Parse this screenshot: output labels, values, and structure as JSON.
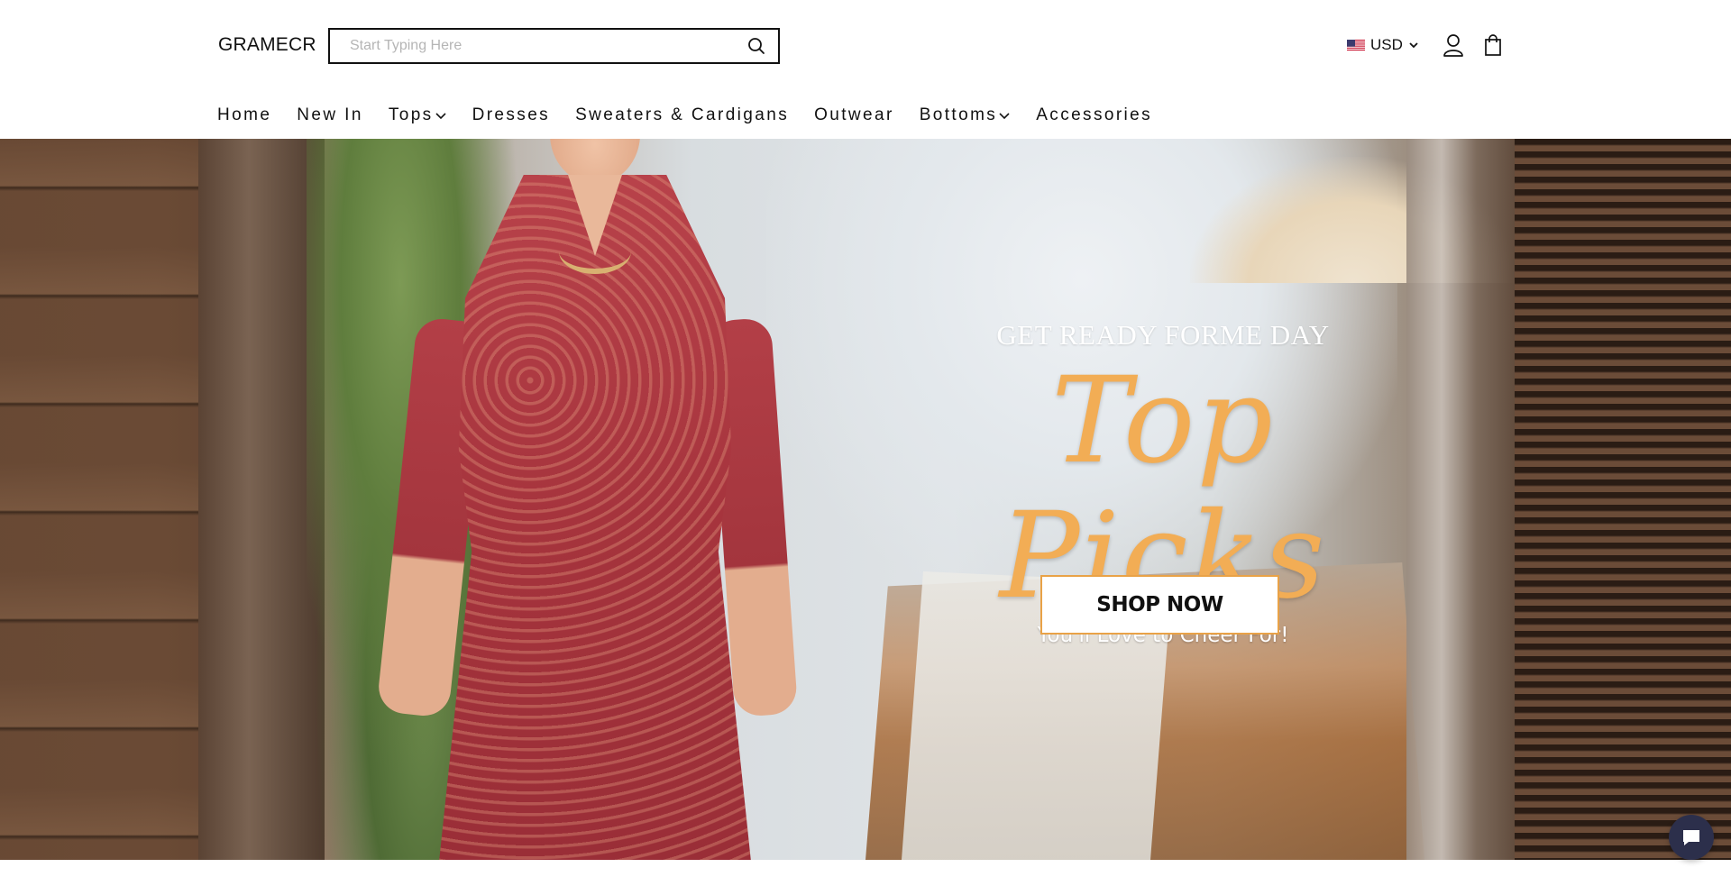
{
  "header": {
    "logo": "GRAMECR",
    "search": {
      "placeholder": "Start Typing Here",
      "value": ""
    },
    "currency": {
      "code": "USD",
      "flag": "us-flag-icon"
    },
    "icons": [
      "search-icon",
      "user-icon",
      "shopping-bag-icon",
      "chevron-down-icon"
    ]
  },
  "nav": {
    "items": [
      {
        "label": "Home",
        "has_dropdown": false
      },
      {
        "label": "New In",
        "has_dropdown": false
      },
      {
        "label": "Tops",
        "has_dropdown": true
      },
      {
        "label": "Dresses",
        "has_dropdown": false
      },
      {
        "label": "Sweaters & Cardigans",
        "has_dropdown": false
      },
      {
        "label": "Outwear",
        "has_dropdown": false
      },
      {
        "label": "Bottoms",
        "has_dropdown": true
      },
      {
        "label": "Accessories",
        "has_dropdown": false
      }
    ]
  },
  "hero": {
    "eyebrow": "GET READY FORME DAY",
    "headline": "Top Picks",
    "subline": "You'll Love to Cheer For!",
    "cta": "SHOP NOW",
    "colors": {
      "headline": "#f2ad55",
      "cta_border": "#e9a247"
    }
  },
  "chat": {
    "icon": "chat-bubble-icon",
    "color": "#2c2f4b"
  }
}
